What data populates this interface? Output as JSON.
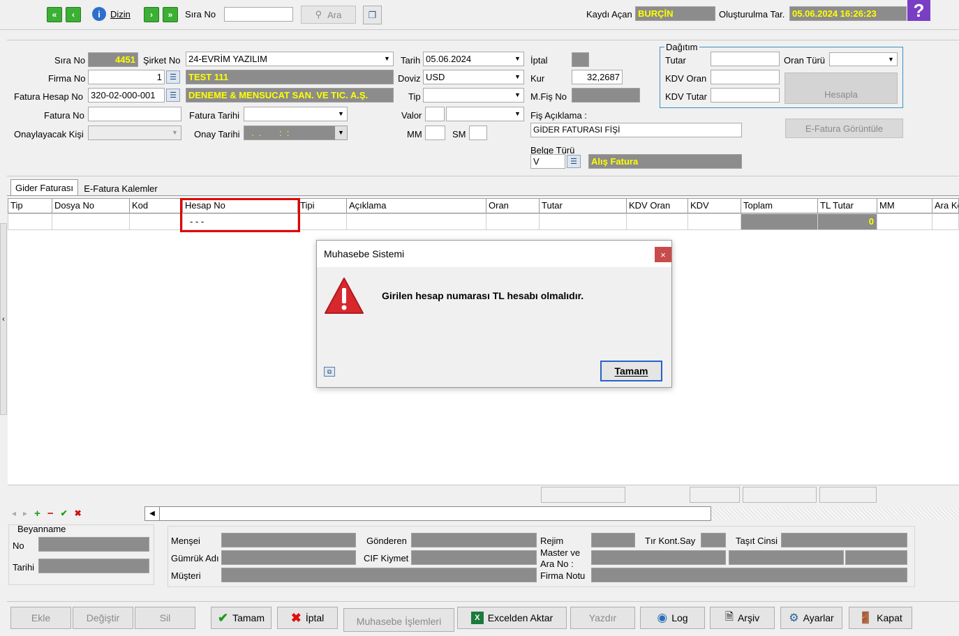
{
  "toolbar": {
    "dizin": "Dizin",
    "sira_no_label": "Sıra No",
    "sira_no_value": "",
    "ara": "Ara",
    "kaydi_acan_label": "Kaydı Açan",
    "kaydi_acan_value": "BURÇİN",
    "olusturma_label": "Oluşturulma Tar.",
    "olusturma_value": "05.06.2024 16:26:23"
  },
  "form": {
    "sira_no_label": "Sıra No",
    "sira_no_value": "4451",
    "sirket_no_label": "Şirket No",
    "sirket_no_value": "24-EVRİM YAZILIM",
    "tarih_label": "Tarih",
    "tarih_value": "05.06.2024",
    "iptal_label": "İptal",
    "firma_no_label": "Firma No",
    "firma_no_value": "1",
    "firma_name": "TEST 111",
    "doviz_label": "Doviz",
    "doviz_value": "USD",
    "kur_label": "Kur",
    "kur_value": "32,2687",
    "fatura_hesap_label": "Fatura Hesap No",
    "fatura_hesap_value": "320-02-000-001",
    "hesap_name": "DENEME & MENSUCAT SAN. VE TIC. A.Ş.",
    "tip_label": "Tip",
    "mfis_label": "M.Fiş No",
    "fatura_no_label": "Fatura No",
    "fatura_tarihi_label": "Fatura Tarihi",
    "valor_label": "Valor",
    "fis_aciklama_label": "Fiş Açıklama :",
    "fis_aciklama_value": "GİDER FATURASI FİŞİ",
    "onaylayacak_label": "Onaylayacak Kişi",
    "onay_tarihi_label": "Onay Tarihi",
    "onay_tarihi_value": "  .  .       :  :",
    "mm_label": "MM",
    "sm_label": "SM",
    "belge_turu_label": "Belge Türü",
    "belge_turu_value": "V",
    "belge_turu_name": "Alış Fatura",
    "e_fatura_btn": "E-Fatura Görüntüle"
  },
  "dagitim": {
    "title": "Dağıtım",
    "tutar_label": "Tutar",
    "oran_turu_label": "Oran Türü",
    "kdv_oran_label": "KDV Oran",
    "kdv_tutar_label": "KDV Tutar",
    "hesapla": "Hesapla"
  },
  "tabs": [
    "Gider Faturası",
    "E-Fatura Kalemler"
  ],
  "grid": {
    "columns": [
      "Tip",
      "Dosya No",
      "Kod",
      "Hesap No",
      "Tipi",
      "Açıklama",
      "Oran",
      "Tutar",
      "KDV Oran",
      "KDV",
      "Toplam",
      "TL Tutar",
      "MM",
      "Ara Ko"
    ],
    "row": {
      "hesap_no": "- - -",
      "tl_tutar": "0"
    }
  },
  "dialog": {
    "title": "Muhasebe Sistemi",
    "message": "Girilen hesap numarası TL hesabı olmalıdır.",
    "ok": "Tamam"
  },
  "beyanname": {
    "title": "Beyanname",
    "no_label": "No",
    "tarihi_label": "Tarihi"
  },
  "customs": {
    "mensei": "Menşei",
    "gonderen": "Gönderen",
    "rejim": "Rejim",
    "tir_kont": "Tır Kont.Say",
    "tasit_cinsi": "Taşıt Cinsi",
    "gumruk_adi": "Gümrük Adı",
    "cif_kiymet": "CIF Kiymet",
    "master_ara_1": "Master ve",
    "master_ara_2": "Ara No :",
    "musteri": "Müşteri",
    "firma_notu": "Firma Notu"
  },
  "buttons": {
    "ekle": "Ekle",
    "degistir": "Değiştir",
    "sil": "Sil",
    "tamam": "Tamam",
    "iptal": "İptal",
    "muhasebe": "Muhasebe İşlemleri",
    "excel": "Excelden Aktar",
    "yazdir": "Yazdır",
    "log": "Log",
    "arsiv": "Arşiv",
    "ayarlar": "Ayarlar",
    "kapat": "Kapat"
  }
}
